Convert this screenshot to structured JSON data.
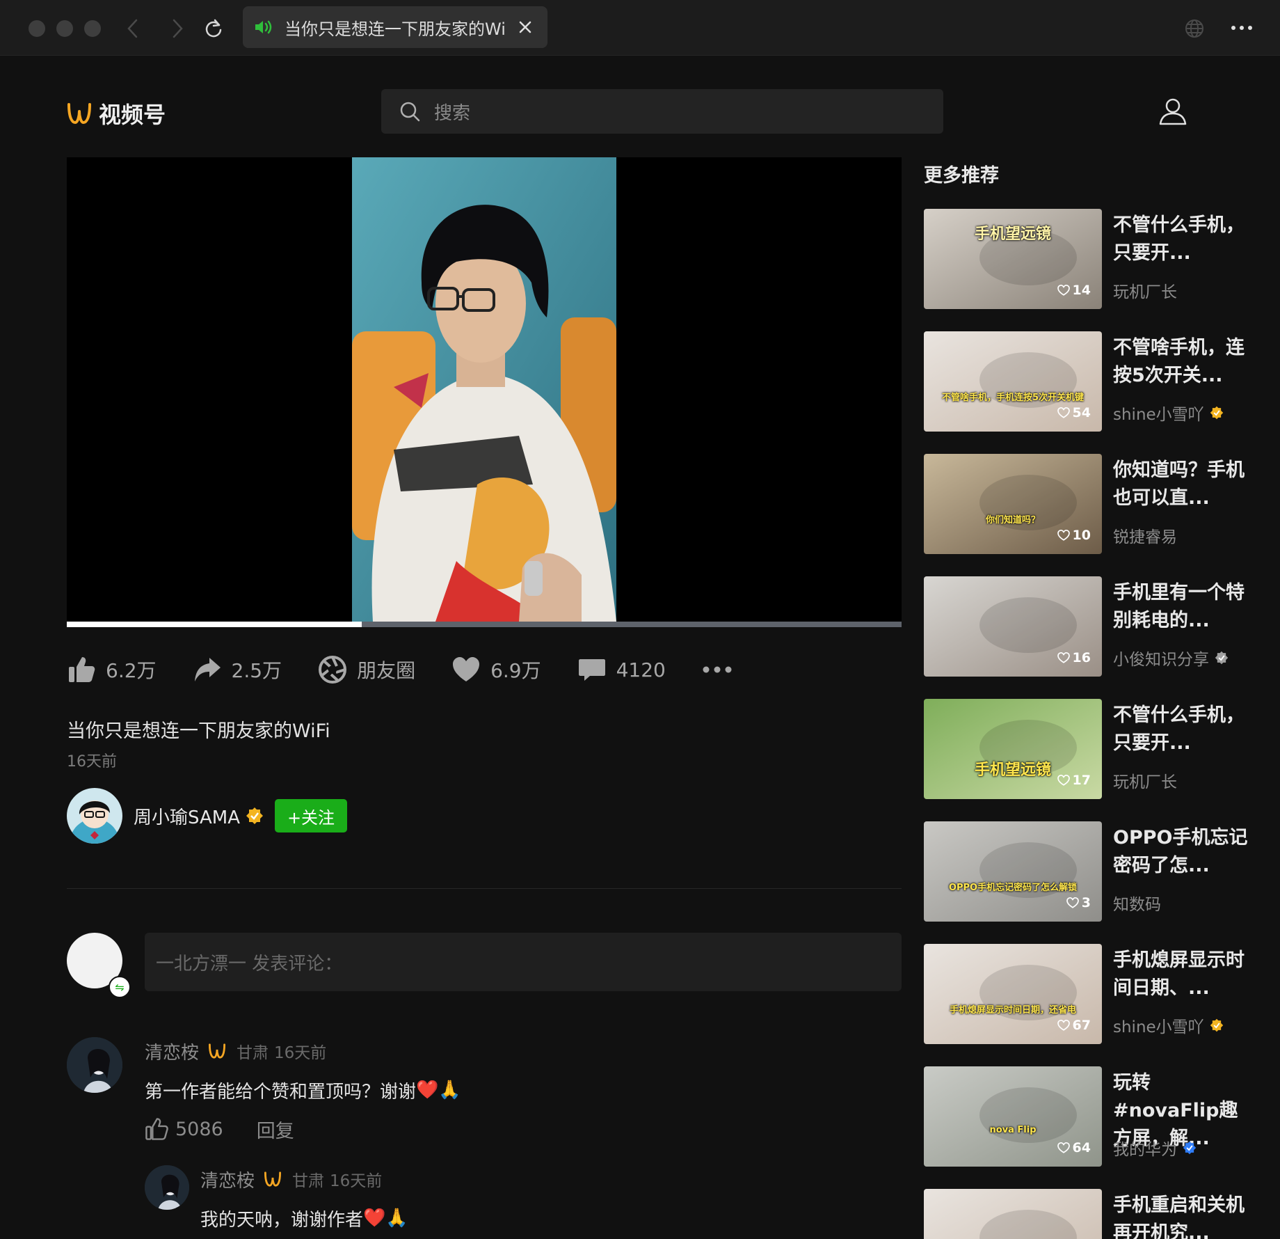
{
  "window": {
    "tab_title": "当你只是想连一下朋友家的WiF",
    "tab_audio_icon": "speaker-icon"
  },
  "header": {
    "app_name": "视频号",
    "search_placeholder": "搜索"
  },
  "video": {
    "progress": 0.353,
    "caption": "当你只是想连一下朋友家的WiFi",
    "posted": "16天前",
    "actions": {
      "like": "6.2万",
      "share": "2.5万",
      "moments": "朋友圈",
      "favorite": "6.9万",
      "comments": "4120"
    },
    "author": {
      "name": "周小瑜SAMA",
      "follow_label": "+关注"
    }
  },
  "comment_input": {
    "placeholder": "一北方漂一 发表评论："
  },
  "comments": [
    {
      "name": "清恋桉",
      "location": "甘肃",
      "time": "16天前",
      "text": "第一作者能给个赞和置顶吗？谢谢",
      "emoji": "❤️🙏",
      "likes": "5086",
      "reply_label": "回复"
    },
    {
      "name": "清恋桉",
      "location": "甘肃",
      "time": "16天前",
      "text": "我的天呐，谢谢作者",
      "emoji": "❤️🙏"
    }
  ],
  "sidebar": {
    "title": "更多推荐",
    "items": [
      {
        "title": "不管什么手机，只要开...",
        "author": "玩机厂长",
        "likes": "14",
        "verified": "",
        "thumb_text": "手机望远镜"
      },
      {
        "title": "不管啥手机，连按5次开关...",
        "author": "shine小雪吖",
        "likes": "54",
        "verified": "gold",
        "thumb_text": "不管啥手机，手机连按5次开关机键"
      },
      {
        "title": "你知道吗？手机也可以直...",
        "author": "锐捷睿易",
        "likes": "10",
        "verified": "",
        "thumb_text": "你们知道吗？"
      },
      {
        "title": "手机里有一个特别耗电的...",
        "author": "小俊知识分享",
        "likes": "16",
        "verified": "gray",
        "thumb_text": ""
      },
      {
        "title": "不管什么手机，只要开...",
        "author": "玩机厂长",
        "likes": "17",
        "verified": "",
        "thumb_text": "手机望远镜"
      },
      {
        "title": "OPPO手机忘记密码了怎...",
        "author": "知数码",
        "likes": "3",
        "verified": "",
        "thumb_text": "OPPO手机忘记密码了怎么解锁"
      },
      {
        "title": "手机熄屏显示时间日期、...",
        "author": "shine小雪吖",
        "likes": "67",
        "verified": "gold",
        "thumb_text": "手机熄屏显示时间日期，还省电"
      },
      {
        "title": "玩转#novaFlip趣方屏，解...",
        "author": "我的华为",
        "likes": "64",
        "verified": "blue",
        "thumb_text": "nova Flip"
      },
      {
        "title": "手机重启和关机再开机究...",
        "author": "",
        "likes": "",
        "verified": "",
        "thumb_text": ""
      }
    ]
  },
  "colors": {
    "accent_green": "#1aad19",
    "logo_orange": "#f5a623",
    "background": "#111111"
  }
}
